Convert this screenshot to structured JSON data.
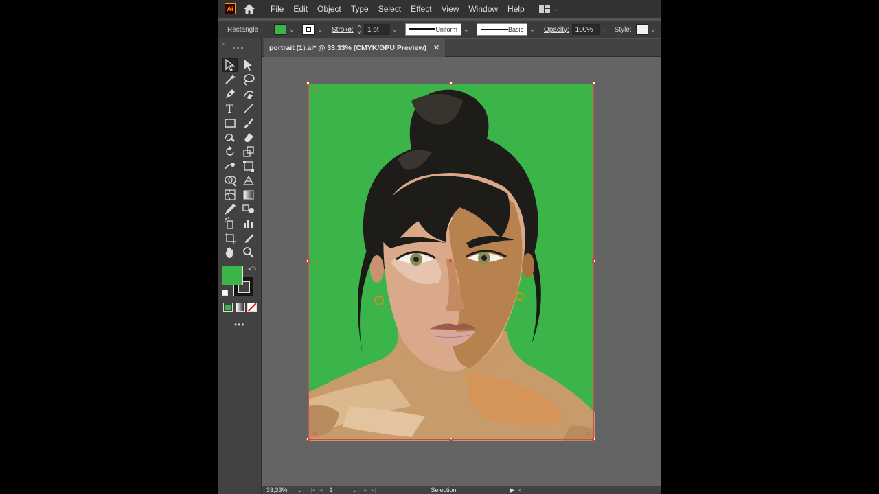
{
  "app": {
    "logo": "Ai"
  },
  "menu": [
    "File",
    "Edit",
    "Object",
    "Type",
    "Select",
    "Effect",
    "View",
    "Window",
    "Help"
  ],
  "control": {
    "selection_type": "Rectangle",
    "fill_color": "#3bb44a",
    "stroke_label": "Stroke:",
    "stroke_weight": "1 pt",
    "profile": "Uniform",
    "brush": "Basic",
    "opacity_label": "Opacity:",
    "opacity_value": "100%",
    "style_label": "Style:"
  },
  "document": {
    "tab_title": "portrait (1).ai* @ 33,33% (CMYK/GPU Preview)",
    "close": "✕"
  },
  "status": {
    "zoom": "33,33%",
    "artboard": "1",
    "tool": "Selection"
  },
  "colors": {
    "ui_dark": "#323232",
    "panel": "#424242",
    "canvas": "#646464",
    "artboard_fill": "#3bb44a",
    "selection": "#d04a4a"
  },
  "tools": [
    "selection-tool",
    "direct-selection-tool",
    "magic-wand-tool",
    "lasso-tool",
    "pen-tool",
    "curvature-tool",
    "type-tool",
    "line-segment-tool",
    "rectangle-tool",
    "paintbrush-tool",
    "shaper-tool",
    "eraser-tool",
    "rotate-tool",
    "scale-tool",
    "warp-tool",
    "free-transform-tool",
    "shape-builder-tool",
    "perspective-grid-tool",
    "mesh-tool",
    "gradient-tool",
    "eyedropper-tool",
    "blend-tool",
    "symbol-sprayer-tool",
    "column-graph-tool",
    "artboard-tool",
    "slice-tool",
    "hand-tool",
    "zoom-tool"
  ],
  "toolbar": {
    "more": "•••"
  }
}
